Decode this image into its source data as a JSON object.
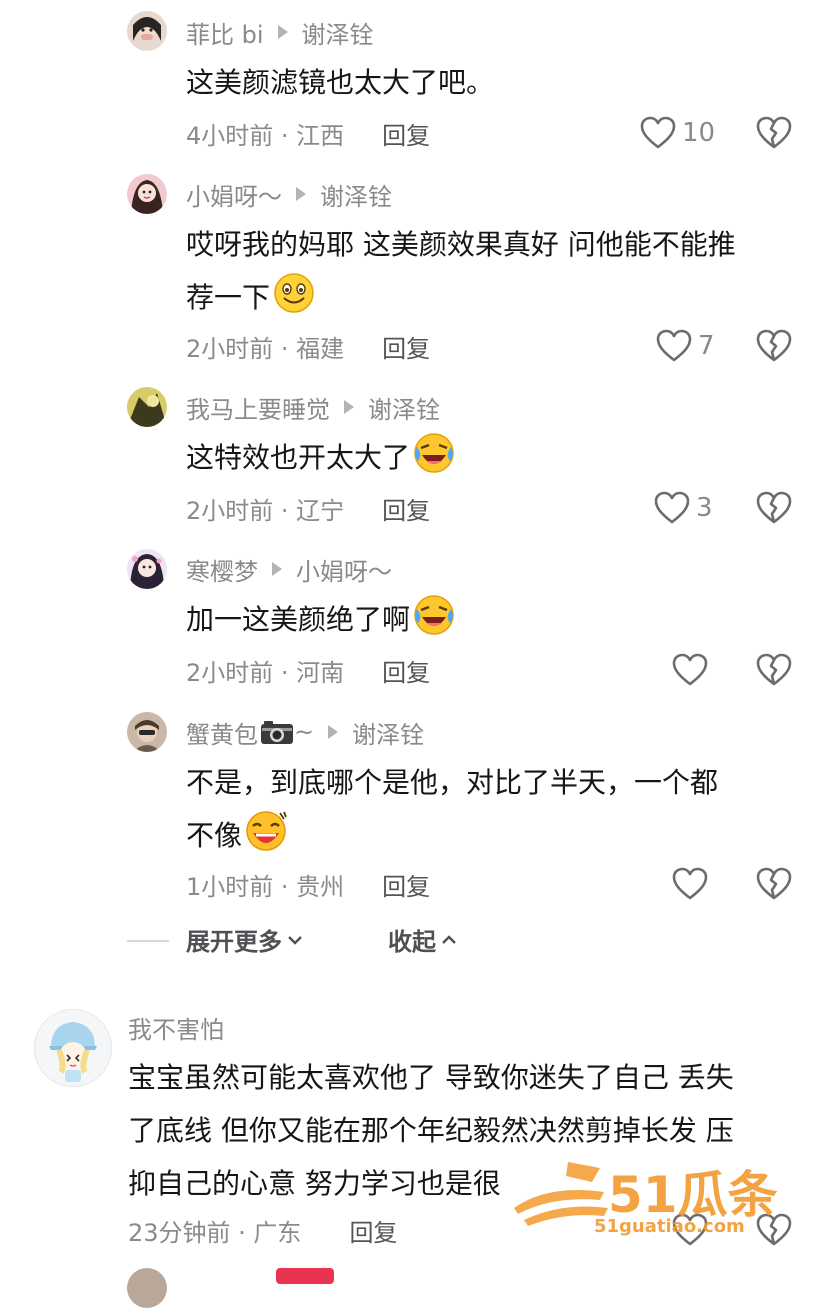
{
  "comments": [
    {
      "author": "菲比 bi",
      "reply_to": "谢泽铨",
      "lines": [
        "这美颜滤镜也太大了吧。"
      ],
      "meta": "4小时前 · 江西",
      "reply_label": "回复",
      "likes": "10"
    },
    {
      "author": "小娟呀～",
      "reply_to": "谢泽铨",
      "lines": [
        "哎呀我的妈耶 这美颜效果真好 问他能不能推",
        "荐一下"
      ],
      "emoji": "smiling-face-emoji",
      "meta": "2小时前 · 福建",
      "reply_label": "回复",
      "likes": "7"
    },
    {
      "author": "我马上要睡觉",
      "reply_to": "谢泽铨",
      "lines": [
        "这特效也开太大了"
      ],
      "emoji": "crying-laughing-emoji",
      "meta": "2小时前 · 辽宁",
      "reply_label": "回复",
      "likes": "3"
    },
    {
      "author": "寒樱梦",
      "reply_to": "小娟呀～",
      "lines": [
        "加一这美颜绝了啊"
      ],
      "emoji": "crying-laughing-emoji",
      "meta": "2小时前 · 河南",
      "reply_label": "回复",
      "likes": ""
    },
    {
      "author": "蟹黄包",
      "author_suffix": "~",
      "reply_to": "谢泽铨",
      "lines": [
        "不是，到底哪个是他，对比了半天，一个都",
        "不像"
      ],
      "emoji": "laughing-emoji",
      "meta": "1小时前 · 贵州",
      "reply_label": "回复",
      "likes": ""
    },
    {
      "author": "我不害怕",
      "lines": [
        "宝宝虽然可能太喜欢他了 导致你迷失了自己 丢失",
        "了底线 但你又能在那个年纪毅然决然剪掉长发 压",
        "抑自己的心意 努力学习也是很"
      ],
      "meta": "23分钟前 · 广东",
      "reply_label": "回复",
      "likes": ""
    }
  ],
  "thread": {
    "expand_label": "展开更多",
    "collapse_label": "收起"
  },
  "watermark": {
    "brand": "51瓜条",
    "url": "51guatiao.com"
  },
  "colors": {
    "text": "#161618",
    "secondary": "#8a8a8e",
    "icon": "#6b6b70",
    "watermark": "#f29a2e"
  }
}
